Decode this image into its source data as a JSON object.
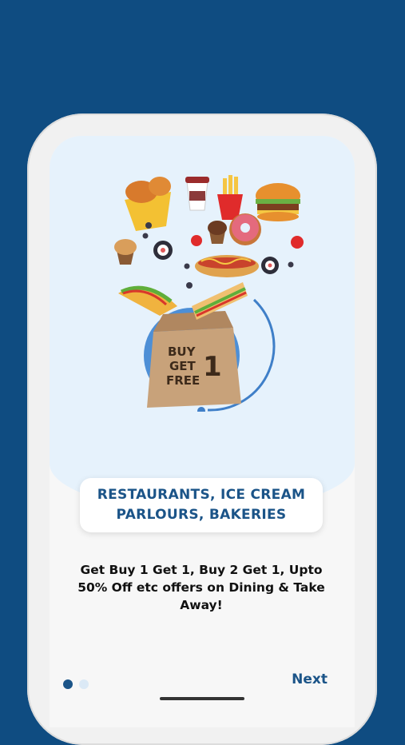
{
  "onboarding": {
    "title": "RESTAURANTS, ICE CREAM PARLOURS, BAKERIES",
    "description": "Get Buy 1 Get 1, Buy 2 Get 1, Upto 50% Off etc offers on Dining & Take Away!",
    "bag_text": {
      "line1": "BUY",
      "line2": "GET",
      "line3": "FREE",
      "number": "1"
    },
    "next_label": "Next",
    "current_page": 1,
    "total_pages": 2
  },
  "colors": {
    "background": "#0f4c81",
    "accent": "#1b5488",
    "hero_bg": "#e6f2fc"
  },
  "icons": [
    "fried-chicken-icon",
    "coffee-cup-icon",
    "fries-icon",
    "burger-icon",
    "muffin-icon",
    "sushi-icon",
    "tomato-icon",
    "donut-icon",
    "hotdog-icon",
    "taco-icon",
    "sandwich-icon",
    "paper-bag-icon"
  ]
}
